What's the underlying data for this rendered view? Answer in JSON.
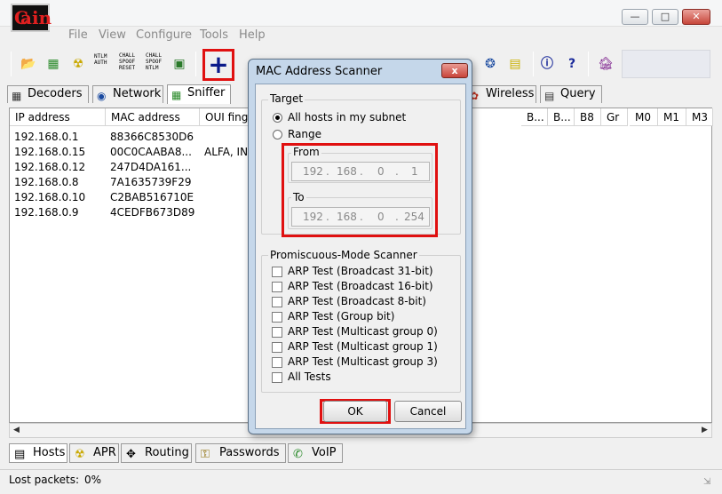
{
  "menu": [
    "File",
    "View",
    "Configure",
    "Tools",
    "Help"
  ],
  "app_logo_text": "ain",
  "toolbar": {
    "ntlm_auth": "NTLM\nAUTH",
    "chall_spoof_reset": "CHALL\nSPOOF\nRESET",
    "chall_spoof_ntlm": "CHALL\nSPOOF\nNTLM",
    "add_label": "+"
  },
  "tabs": [
    "Decoders",
    "Network",
    "Sniffer",
    "Wireless",
    "Query"
  ],
  "table": {
    "headers": [
      "IP address",
      "MAC address",
      "OUI fing",
      "B...",
      "B...",
      "B8",
      "Gr",
      "M0",
      "M1",
      "M3"
    ],
    "rows": [
      {
        "ip": "192.168.0.1",
        "mac": "88366C8530D6",
        "oui": ""
      },
      {
        "ip": "192.168.0.15",
        "mac": "00C0CAABA8...",
        "oui": "ALFA, IN"
      },
      {
        "ip": "192.168.0.12",
        "mac": "247D4DA161...",
        "oui": ""
      },
      {
        "ip": "192.168.0.8",
        "mac": "7A1635739F29",
        "oui": ""
      },
      {
        "ip": "192.168.0.10",
        "mac": "C2BAB516710E",
        "oui": ""
      },
      {
        "ip": "192.168.0.9",
        "mac": "4CEDFB673D89",
        "oui": ""
      }
    ]
  },
  "bottom_tabs": [
    "Hosts",
    "APR",
    "Routing",
    "Passwords",
    "VoIP"
  ],
  "status": {
    "label": "Lost packets:",
    "value": "0%"
  },
  "dialog": {
    "title": "MAC Address Scanner",
    "close": "x",
    "target_legend": "Target",
    "opt_all": "All hosts in my subnet",
    "opt_range": "Range",
    "from_legend": "From",
    "from_ip": [
      "192",
      "168",
      "0",
      "1"
    ],
    "to_legend": "To",
    "to_ip": [
      "192",
      "168",
      "0",
      "254"
    ],
    "promisc_legend": "Promiscuous-Mode Scanner",
    "tests": [
      "ARP Test (Broadcast 31-bit)",
      "ARP Test (Broadcast 16-bit)",
      "ARP Test (Broadcast 8-bit)",
      "ARP Test (Group bit)",
      "ARP Test (Multicast group 0)",
      "ARP Test (Multicast group 1)",
      "ARP Test (Multicast group 3)",
      "All Tests"
    ],
    "ok": "OK",
    "cancel": "Cancel"
  }
}
